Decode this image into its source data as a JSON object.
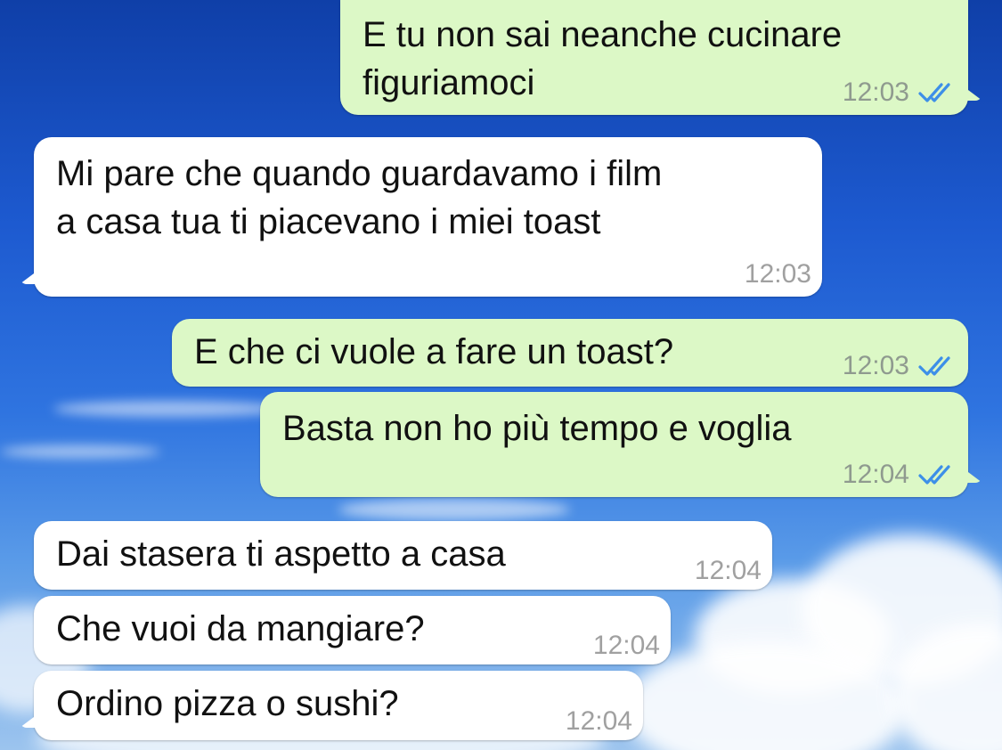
{
  "colors": {
    "outgoing_bubble": "#dcf8c6",
    "incoming_bubble": "#ffffff",
    "read_ticks": "#3d8fe8",
    "background_sky": "#1d5ad0"
  },
  "icons": {
    "read_receipt": "double-check-icon"
  },
  "messages": [
    {
      "direction": "out",
      "text": "E tu non sai neanche cucinare\nfiguriamoci",
      "time": "12:03",
      "status": "read"
    },
    {
      "direction": "in",
      "text": "Mi pare che quando guardavamo i film\na casa tua ti piacevano i miei toast",
      "time": "12:03"
    },
    {
      "direction": "out",
      "text": "E che ci vuole a fare un toast?",
      "time": "12:03",
      "status": "read"
    },
    {
      "direction": "out",
      "text": "Basta non ho più tempo e voglia",
      "time": "12:04",
      "status": "read"
    },
    {
      "direction": "in",
      "text": "Dai stasera ti aspetto a casa",
      "time": "12:04"
    },
    {
      "direction": "in",
      "text": "Che vuoi da mangiare?",
      "time": "12:04"
    },
    {
      "direction": "in",
      "text": "Ordino pizza o sushi?",
      "time": "12:04"
    }
  ]
}
